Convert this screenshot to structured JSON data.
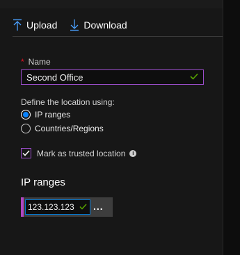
{
  "toolbar": {
    "upload_label": "Upload",
    "download_label": "Download"
  },
  "form": {
    "name_label": "Name",
    "required_mark": "*",
    "name_value": "Second Office",
    "define_label": "Define the location using:",
    "options": [
      {
        "label": "IP ranges",
        "selected": true
      },
      {
        "label": "Countries/Regions",
        "selected": false
      }
    ],
    "trusted_label": "Mark as trusted location",
    "trusted_checked": true,
    "info_glyph": "i"
  },
  "ip_ranges": {
    "title": "IP ranges",
    "value": "123.123.123",
    "more_label": "..."
  },
  "colors": {
    "accent_purple": "#9b4dca",
    "accent_blue": "#0078d4",
    "valid_green": "#57a300",
    "required_red": "#e81123"
  }
}
